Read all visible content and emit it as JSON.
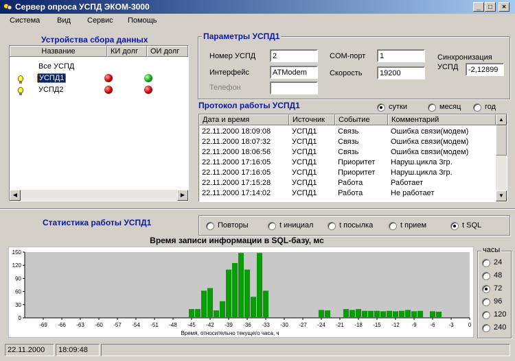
{
  "window": {
    "title": "Сервер опроса УСПД ЭКОМ-3000",
    "minimize": "_",
    "maximize": "□",
    "close": "×"
  },
  "menu": [
    "Система",
    "Вид",
    "Сервис",
    "Помощь"
  ],
  "devices": {
    "title": "Устройства сбора данных",
    "columns": [
      "Название",
      "КИ долг",
      "ОИ долг"
    ],
    "items": [
      {
        "name": "Все УСПД",
        "ki": null,
        "oi": null
      },
      {
        "name": "УСПД1",
        "ki": "red",
        "oi": "green",
        "selected": true
      },
      {
        "name": "УСПД2",
        "ki": "red",
        "oi": "red"
      }
    ]
  },
  "params": {
    "title": "Параметры УСПД1",
    "number_label": "Номер УСПД",
    "number_value": "2",
    "interface_label": "Интерфейс",
    "interface_value": "ATModem",
    "phone_label": "Телефон",
    "phone_value": "",
    "com_label": "COM-порт",
    "com_value": "1",
    "speed_label": "Скорость",
    "speed_value": "19200",
    "sync_label1": "Синхронизация",
    "sync_label2": "УСПД",
    "sync_value": "-2,12899"
  },
  "protocol": {
    "title": "Протокол работы УСПД1",
    "periods": [
      {
        "label": "сутки",
        "on": true
      },
      {
        "label": "месяц",
        "on": false
      },
      {
        "label": "год",
        "on": false
      }
    ],
    "columns": [
      "Дата и время",
      "Источник",
      "Событие",
      "Комментарий"
    ],
    "rows": [
      [
        "22.11.2000 18:09:08",
        "УСПД1",
        "Связь",
        "Ошибка связи(модем)"
      ],
      [
        "22.11.2000 18:07:32",
        "УСПД1",
        "Связь",
        "Ошибка связи(модем)"
      ],
      [
        "22.11.2000 18:06:56",
        "УСПД1",
        "Связь",
        "Ошибка связи(модем)"
      ],
      [
        "22.11.2000 17:16:05",
        "УСПД1",
        "Приоритет",
        "Наруш.цикла 3гр."
      ],
      [
        "22.11.2000 17:16:05",
        "УСПД1",
        "Приоритет",
        "Наруш.цикла 3гр."
      ],
      [
        "22.11.2000 17:15:28",
        "УСПД1",
        "Работа",
        "Работает"
      ],
      [
        "22.11.2000 17:14:02",
        "УСПД1",
        "Работа",
        "Не работает"
      ]
    ]
  },
  "stats": {
    "title": "Статистика работы УСПД1",
    "modes": [
      {
        "label": "Повторы",
        "on": false
      },
      {
        "label": "t инициал",
        "on": false
      },
      {
        "label": "t посылка",
        "on": false
      },
      {
        "label": "t прием",
        "on": false
      },
      {
        "label": "t SQL",
        "on": true
      }
    ],
    "hours_label": "часы",
    "hours": [
      {
        "label": "24",
        "on": false
      },
      {
        "label": "48",
        "on": false
      },
      {
        "label": "72",
        "on": true
      },
      {
        "label": "96",
        "on": false
      },
      {
        "label": "120",
        "on": false
      },
      {
        "label": "240",
        "on": false
      }
    ]
  },
  "chart_data": {
    "type": "bar",
    "title": "Время записи информации в SQL-базу, мс",
    "xlabel": "Время, относительно текущего часа,  ч",
    "ylabel": "",
    "ylim": [
      0,
      150
    ],
    "yticks": [
      0,
      30,
      60,
      90,
      120,
      150
    ],
    "xlim": [
      -72,
      0
    ],
    "xticks": [
      -69,
      -66,
      -63,
      -60,
      -57,
      -54,
      -51,
      -48,
      -45,
      -42,
      -39,
      -36,
      -33,
      -30,
      -27,
      -24,
      -21,
      -18,
      -15,
      -12,
      -9,
      -6,
      -3,
      0
    ],
    "x": [
      -45,
      -44,
      -43,
      -42,
      -41,
      -40,
      -39,
      -38,
      -37,
      -36,
      -35,
      -34,
      -33,
      -24,
      -23,
      -20,
      -19,
      -18,
      -17,
      -16,
      -15,
      -14,
      -13,
      -12,
      -11,
      -10,
      -9,
      -8,
      -6,
      -5
    ],
    "values": [
      20,
      20,
      62,
      68,
      17,
      38,
      110,
      125,
      148,
      110,
      48,
      148,
      62,
      18,
      17,
      20,
      18,
      20,
      16,
      16,
      16,
      15,
      16,
      15,
      16,
      18,
      15,
      16,
      15,
      14
    ],
    "bar_color": "#0a9a0a",
    "plot_bg": "#c8c8c8",
    "grid": false
  },
  "status": {
    "date": "22.11.2000",
    "time": "18:09:48"
  },
  "colors": {
    "accent": "#0a246a",
    "section_title": "#0a1aa0"
  }
}
